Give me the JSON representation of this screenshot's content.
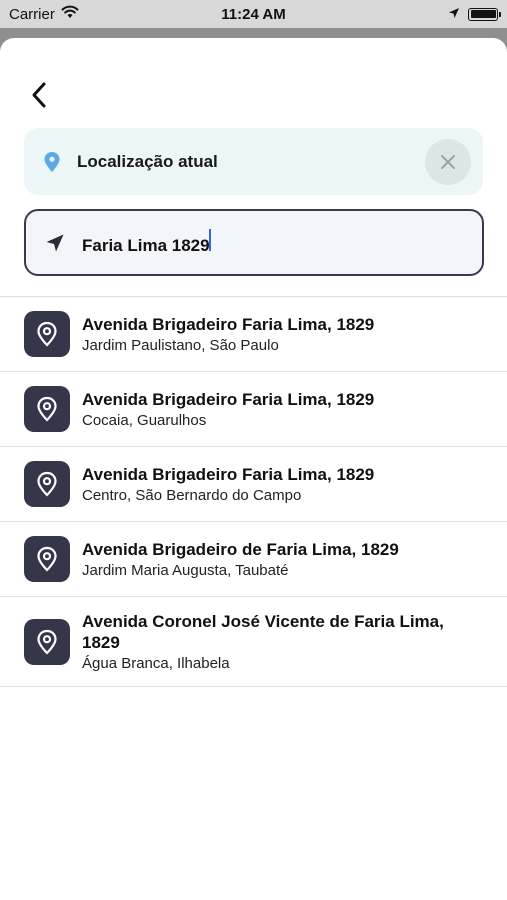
{
  "status_bar": {
    "carrier": "Carrier",
    "time": "11:24 AM",
    "icons": [
      "wifi-icon",
      "location-arrow-icon",
      "battery-icon"
    ]
  },
  "header": {
    "back_icon": "chevron-left-icon"
  },
  "current_location": {
    "icon": "map-pin-icon",
    "label": "Localização atual",
    "clear_icon": "close-icon"
  },
  "search": {
    "icon": "navigation-arrow-icon",
    "value": "Faria Lima 1829"
  },
  "results": [
    {
      "title": "Avenida Brigadeiro Faria Lima, 1829",
      "subtitle": "Jardim Paulistano, São Paulo",
      "icon": "location-pin-icon"
    },
    {
      "title": "Avenida Brigadeiro Faria Lima, 1829",
      "subtitle": "Cocaia, Guarulhos",
      "icon": "location-pin-icon"
    },
    {
      "title": "Avenida Brigadeiro Faria Lima, 1829",
      "subtitle": "Centro, São Bernardo do Campo",
      "icon": "location-pin-icon"
    },
    {
      "title": "Avenida Brigadeiro de Faria Lima, 1829",
      "subtitle": "Jardim Maria Augusta, Taubaté",
      "icon": "location-pin-icon"
    },
    {
      "title": "Avenida Coronel José Vicente de Faria Lima, 1829",
      "subtitle": "Água Branca, Ilhabela",
      "icon": "location-pin-icon"
    }
  ],
  "colors": {
    "accent_pin": "#5aa9e6",
    "result_icon_bg": "#35364a",
    "current_location_bg": "#edf6f6",
    "search_border": "#3a3a4e",
    "caret": "#2f6be0"
  }
}
